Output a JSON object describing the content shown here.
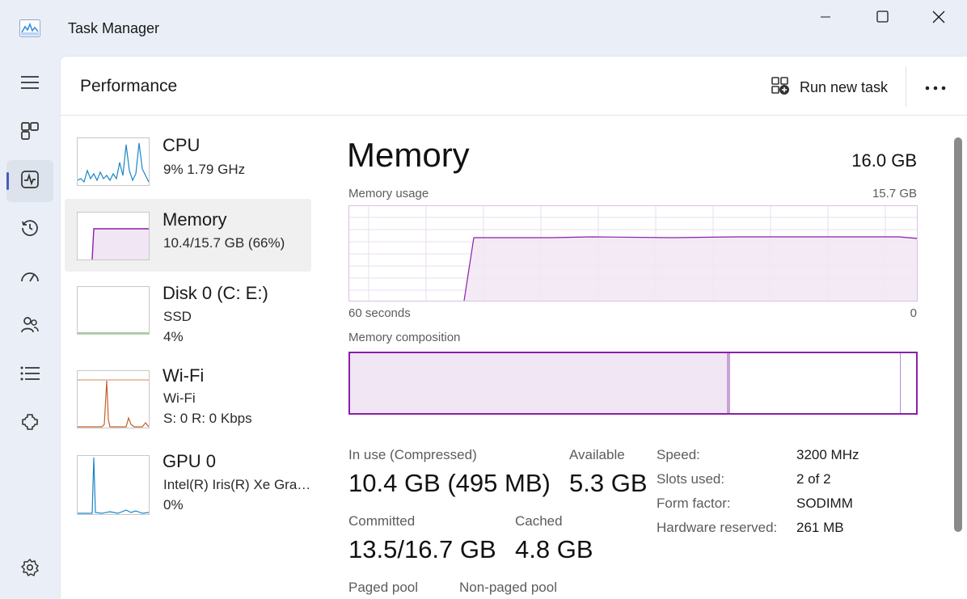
{
  "window": {
    "title": "Task Manager",
    "minimize_icon": "minimize-icon",
    "maximize_icon": "maximize-icon",
    "close_icon": "close-icon"
  },
  "nav": {
    "items": [
      {
        "name": "hamburger-menu-icon"
      },
      {
        "name": "processes-icon"
      },
      {
        "name": "performance-icon",
        "active": true
      },
      {
        "name": "app-history-icon"
      },
      {
        "name": "startup-apps-icon"
      },
      {
        "name": "users-icon"
      },
      {
        "name": "details-icon"
      },
      {
        "name": "services-icon"
      },
      {
        "name": "settings-icon"
      }
    ]
  },
  "header": {
    "title": "Performance",
    "run_new_task": "Run new task",
    "more_icon": "more-options-icon"
  },
  "resources": [
    {
      "name": "CPU",
      "sub1": "9%  1.79 GHz",
      "sub2": ""
    },
    {
      "name": "Memory",
      "sub1": "10.4/15.7 GB (66%)",
      "sub2": "",
      "selected": true
    },
    {
      "name": "Disk 0 (C: E:)",
      "sub1": "SSD",
      "sub2": "4%"
    },
    {
      "name": "Wi-Fi",
      "sub1": "Wi-Fi",
      "sub2": "S: 0  R: 0 Kbps"
    },
    {
      "name": "GPU 0",
      "sub1": "Intel(R) Iris(R) Xe Grap...",
      "sub2": "0%"
    }
  ],
  "detail": {
    "title": "Memory",
    "total": "16.0 GB",
    "usage_label": "Memory usage",
    "usage_max": "15.7 GB",
    "axis_left": "60 seconds",
    "axis_right": "0",
    "composition_label": "Memory composition",
    "composition": {
      "in_use_fraction": 0.66,
      "modified_fraction": 0.004,
      "standby_fraction": 0.3
    },
    "stats": {
      "in_use_label": "In use (Compressed)",
      "in_use_value": "10.4 GB (495 MB)",
      "available_label": "Available",
      "available_value": "5.3 GB",
      "committed_label": "Committed",
      "committed_value": "13.5/16.7 GB",
      "cached_label": "Cached",
      "cached_value": "4.8 GB",
      "paged_pool_label": "Paged pool",
      "nonpaged_pool_label": "Non-paged pool"
    },
    "specs": [
      {
        "label": "Speed:",
        "value": "3200 MHz"
      },
      {
        "label": "Slots used:",
        "value": "2 of 2"
      },
      {
        "label": "Form factor:",
        "value": "SODIMM"
      },
      {
        "label": "Hardware reserved:",
        "value": "261 MB"
      }
    ]
  },
  "colors": {
    "memory_accent": "#8b1fa9",
    "memory_fill": "#f1e6f4",
    "cpu_accent": "#1a86c7",
    "wifi_accent": "#c0622a",
    "gpu_accent": "#1a86c7",
    "nav_indicator": "#4a5bbd"
  }
}
